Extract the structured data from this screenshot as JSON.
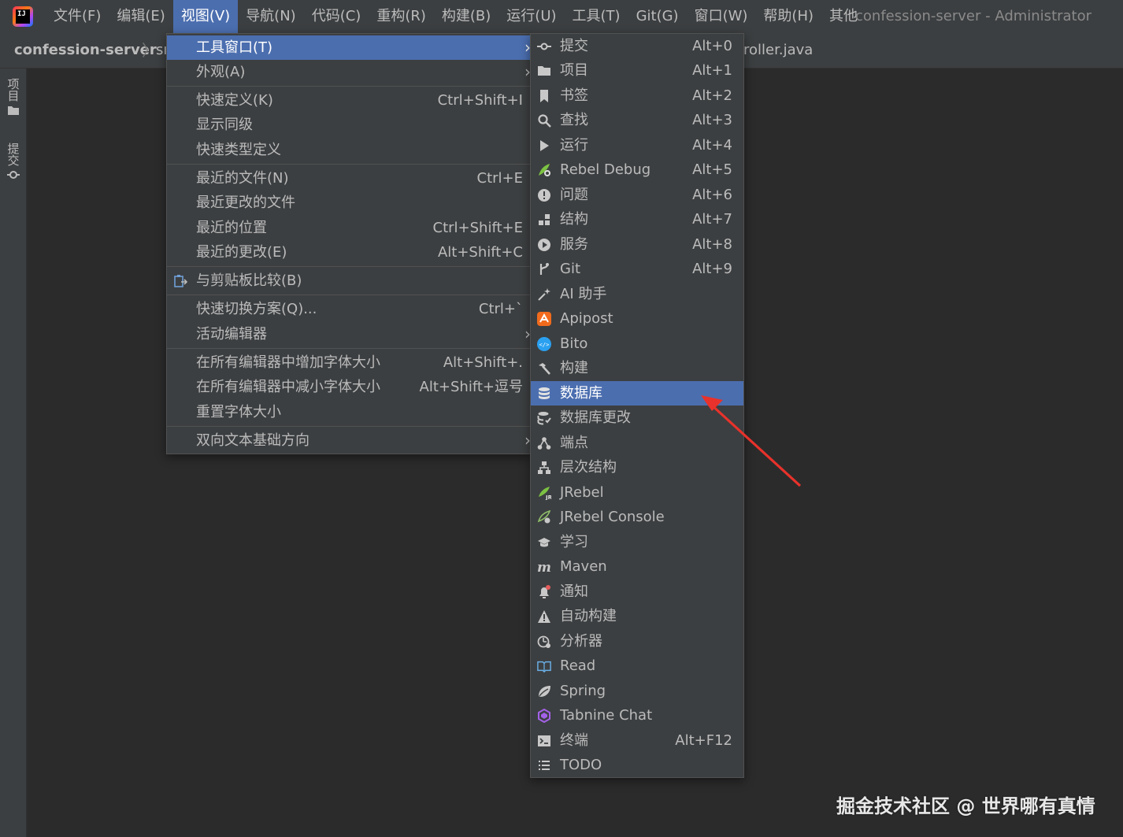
{
  "menubar": {
    "items": [
      {
        "label": "文件(F)"
      },
      {
        "label": "编辑(E)"
      },
      {
        "label": "视图(V)"
      },
      {
        "label": "导航(N)"
      },
      {
        "label": "代码(C)"
      },
      {
        "label": "重构(R)"
      },
      {
        "label": "构建(B)"
      },
      {
        "label": "运行(U)"
      },
      {
        "label": "工具(T)"
      },
      {
        "label": "Git(G)"
      },
      {
        "label": "窗口(W)"
      },
      {
        "label": "帮助(H)"
      },
      {
        "label": "其他"
      }
    ],
    "window_title": "confession-server - Administrator"
  },
  "navbar": {
    "project": "confession-server",
    "next_crumb": "sı",
    "editor_tab_fragment": "roller.java"
  },
  "tool_stripe": {
    "project_label": "项目",
    "commit_label": "提交"
  },
  "view_menu": {
    "items": [
      {
        "label": "工具窗口(T)",
        "shortcut": "",
        "submenu": true
      },
      {
        "label": "外观(A)",
        "shortcut": "",
        "submenu": true
      },
      {
        "label": "快速定义(K)",
        "shortcut": "Ctrl+Shift+I"
      },
      {
        "label": "显示同级",
        "shortcut": ""
      },
      {
        "label": "快速类型定义",
        "shortcut": ""
      },
      {
        "label": "最近的文件(N)",
        "shortcut": "Ctrl+E"
      },
      {
        "label": "最近更改的文件",
        "shortcut": ""
      },
      {
        "label": "最近的位置",
        "shortcut": "Ctrl+Shift+E"
      },
      {
        "label": "最近的更改(E)",
        "shortcut": "Alt+Shift+C"
      },
      {
        "label": "与剪贴板比较(B)",
        "shortcut": ""
      },
      {
        "label": "快速切换方案(Q)...",
        "shortcut": "Ctrl+`"
      },
      {
        "label": "活动编辑器",
        "shortcut": "",
        "submenu": true
      },
      {
        "label": "在所有编辑器中增加字体大小",
        "shortcut": "Alt+Shift+."
      },
      {
        "label": "在所有编辑器中减小字体大小",
        "shortcut": "Alt+Shift+逗号"
      },
      {
        "label": "重置字体大小",
        "shortcut": ""
      },
      {
        "label": "双向文本基础方向",
        "shortcut": "",
        "submenu": true
      }
    ]
  },
  "tool_menu": {
    "items": [
      {
        "label": "提交",
        "shortcut": "Alt+0",
        "icon": "commit-icon"
      },
      {
        "label": "项目",
        "shortcut": "Alt+1",
        "icon": "folder-icon"
      },
      {
        "label": "书签",
        "shortcut": "Alt+2",
        "icon": "bookmark-icon"
      },
      {
        "label": "查找",
        "shortcut": "Alt+3",
        "icon": "search-icon"
      },
      {
        "label": "运行",
        "shortcut": "Alt+4",
        "icon": "run-icon"
      },
      {
        "label": "Rebel Debug",
        "shortcut": "Alt+5",
        "icon": "jrebel-debug-icon"
      },
      {
        "label": "问题",
        "shortcut": "Alt+6",
        "icon": "problems-icon"
      },
      {
        "label": "结构",
        "shortcut": "Alt+7",
        "icon": "structure-icon"
      },
      {
        "label": "服务",
        "shortcut": "Alt+8",
        "icon": "services-icon"
      },
      {
        "label": "Git",
        "shortcut": "Alt+9",
        "icon": "git-branch-icon"
      },
      {
        "label": "AI 助手",
        "shortcut": "",
        "icon": "ai-sparkle-icon"
      },
      {
        "label": "Apipost",
        "shortcut": "",
        "icon": "apipost-icon"
      },
      {
        "label": "Bito",
        "shortcut": "",
        "icon": "bito-icon"
      },
      {
        "label": "构建",
        "shortcut": "",
        "icon": "hammer-icon"
      },
      {
        "label": "数据库",
        "shortcut": "",
        "icon": "database-icon"
      },
      {
        "label": "数据库更改",
        "shortcut": "",
        "icon": "database-changes-icon"
      },
      {
        "label": "端点",
        "shortcut": "",
        "icon": "endpoints-icon"
      },
      {
        "label": "层次结构",
        "shortcut": "",
        "icon": "hierarchy-icon"
      },
      {
        "label": "JRebel",
        "shortcut": "",
        "icon": "jrebel-icon"
      },
      {
        "label": "JRebel Console",
        "shortcut": "",
        "icon": "jrebel-console-icon"
      },
      {
        "label": "学习",
        "shortcut": "",
        "icon": "learn-cap-icon"
      },
      {
        "label": "Maven",
        "shortcut": "",
        "icon": "maven-icon"
      },
      {
        "label": "通知",
        "shortcut": "",
        "icon": "notification-bell-icon"
      },
      {
        "label": "自动构建",
        "shortcut": "",
        "icon": "warning-triangle-icon"
      },
      {
        "label": "分析器",
        "shortcut": "",
        "icon": "profiler-icon"
      },
      {
        "label": "Read",
        "shortcut": "",
        "icon": "book-icon"
      },
      {
        "label": "Spring",
        "shortcut": "",
        "icon": "spring-leaf-icon"
      },
      {
        "label": "Tabnine Chat",
        "shortcut": "",
        "icon": "tabnine-icon"
      },
      {
        "label": "终端",
        "shortcut": "Alt+F12",
        "icon": "terminal-icon"
      },
      {
        "label": "TODO",
        "shortcut": "",
        "icon": "todo-list-icon"
      }
    ]
  },
  "watermark": "掘金技术社区 @ 世界哪有真情",
  "colors": {
    "background": "#2b2b2b",
    "chrome": "#3c3f41",
    "highlight": "#4b6eaf",
    "annotation_arrow": "#e8322b"
  }
}
